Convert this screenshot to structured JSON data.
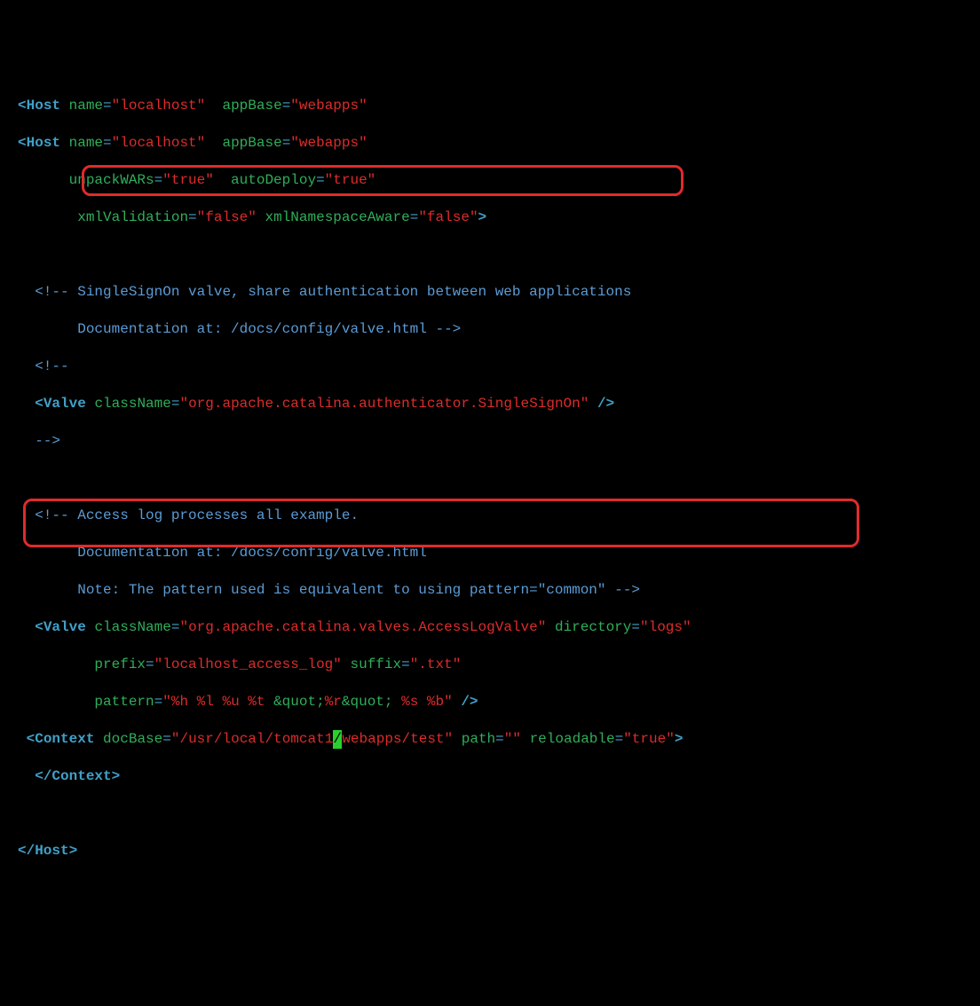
{
  "line1": {
    "tag_open": "<",
    "tag": "Host",
    "attr_name_name": "name",
    "attr_name_val": "\"localhost\"",
    "attr_appbase_name": "appBase",
    "attr_appbase_val": "\"webapps\""
  },
  "line2": {
    "tag_open": "<",
    "tag": "Host",
    "attr_name_name": "name",
    "attr_name_val": "\"localhost\"",
    "attr_appbase_name": "appBase",
    "attr_appbase_val": "\"webapps\""
  },
  "line3": {
    "attr_unpack_name": "unpackWARs",
    "attr_unpack_val": "\"true\"",
    "attr_autodeploy_name": "autoDeploy",
    "attr_autodeploy_val": "\"true\""
  },
  "line4": {
    "attr_xmlval_name": "xmlValidation",
    "attr_xmlval_val": "\"false\"",
    "attr_xmlns_name": "xmlNamespaceAware",
    "attr_xmlns_val": "\"false\"",
    "tag_close": ">"
  },
  "line6a": "<!-- SingleSignOn valve, share authentication between web applications",
  "line6b": "     Documentation at: /docs/config/valve.html -->",
  "line7": "<!--",
  "line8": {
    "tag_open": "<",
    "tag": "Valve",
    "attr_class_name": "className",
    "attr_class_val": "\"org.apache.catalina.authenticator.SingleSignOn\"",
    "tag_close": " />"
  },
  "line9": "-->",
  "line11a": "<!-- Access log processes all example.",
  "line11b": "     Documentation at: /docs/config/valve.html",
  "line11c": "     Note: The pattern used is equivalent to using pattern=\"common\" -->",
  "line12": {
    "tag_open": "<",
    "tag": "Valve",
    "attr_class_name": "className",
    "attr_class_val": "\"org.apache.catalina.valves.AccessLogValve\"",
    "attr_dir_name": "directory",
    "attr_dir_val": "\"logs\""
  },
  "line13": {
    "attr_prefix_name": "prefix",
    "attr_prefix_val": "\"localhost_access_log\"",
    "attr_suffix_name": "suffix",
    "attr_suffix_val": "\".txt\""
  },
  "line14": {
    "attr_pattern_name": "pattern",
    "val_a": "\"%h %l %u %t ",
    "amp1": "&quot;",
    "val_b": "%r",
    "amp2": "&quot;",
    "val_c": " %s %b\"",
    "tag_close": " />"
  },
  "line15": {
    "tag_open": "<",
    "tag": "Context",
    "attr_doc_name": "docBase",
    "val_a": "\"/usr/local/tomcat1",
    "cursor_char": "/",
    "val_b": "webapps/test\"",
    "attr_path_name": "path",
    "attr_path_val": "\"\"",
    "attr_reload_name": "reloadable",
    "attr_reload_val": "\"true\"",
    "tag_close": ">"
  },
  "line16": {
    "tag_open": "</",
    "tag": "Context",
    "tag_close": ">"
  },
  "line18": {
    "tag_open": "</",
    "tag": "Host",
    "tag_close": ">"
  }
}
